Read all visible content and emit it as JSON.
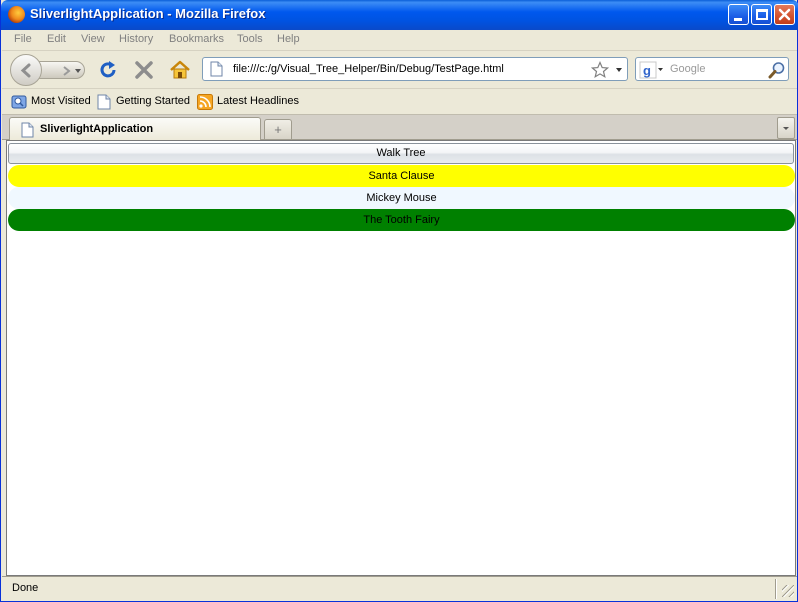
{
  "window": {
    "title": "SliverlightApplication - Mozilla Firefox",
    "controls": {
      "minimize": "minimize-icon",
      "maximize": "maximize-icon",
      "close": "close-icon"
    }
  },
  "menu": {
    "items": [
      {
        "label": "File"
      },
      {
        "label": "Edit"
      },
      {
        "label": "View"
      },
      {
        "label": "History"
      },
      {
        "label": "Bookmarks"
      },
      {
        "label": "Tools"
      },
      {
        "label": "Help"
      }
    ]
  },
  "navigation": {
    "url": "file:///c:/g/Visual_Tree_Helper/Bin/Debug/TestPage.html",
    "search_placeholder": "Google",
    "icons": {
      "back": "back-arrow-icon",
      "forward": "forward-arrow-icon",
      "reload": "reload-icon",
      "stop": "stop-icon",
      "home": "home-icon",
      "bookmark_star": "star-icon",
      "search_engine": "google-icon",
      "search_go": "magnifier-icon"
    }
  },
  "bookmarks": {
    "items": [
      {
        "label": "Most Visited",
        "icon": "most-visited-icon"
      },
      {
        "label": "Getting Started",
        "icon": "page-icon"
      },
      {
        "label": "Latest Headlines",
        "icon": "rss-feed-icon"
      }
    ]
  },
  "tabs": {
    "items": [
      {
        "label": "SliverlightApplication",
        "icon": "page-icon",
        "active": true
      }
    ],
    "new_tab_symbol": "+"
  },
  "content": {
    "button_label": "Walk Tree",
    "rows": [
      {
        "text": "Santa Clause",
        "color": "#ffff00"
      },
      {
        "text": "Mickey Mouse",
        "color": "#f0f8ff"
      },
      {
        "text": "The Tooth Fairy",
        "color": "#008000"
      }
    ]
  },
  "status": {
    "text": "Done"
  },
  "colors": {
    "titlebar": "#0058ee",
    "chrome": "#ece9d8",
    "close_button": "#d2512d"
  }
}
